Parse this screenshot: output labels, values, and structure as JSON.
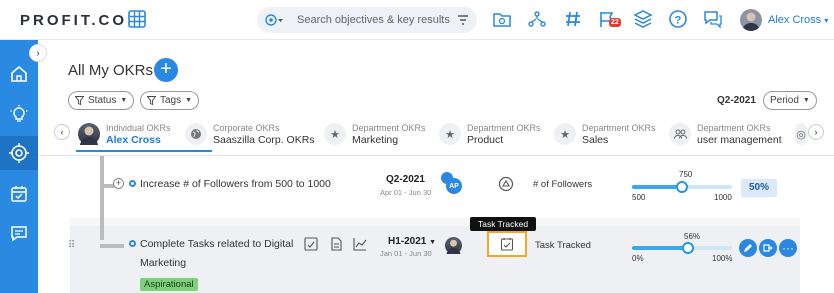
{
  "header": {
    "logo_text": "PROFIT.CO",
    "search_placeholder": "Search objectives & key results",
    "notification_count": "22",
    "user_name": "Alex Cross",
    "icons": [
      "grid-icon",
      "target-icon",
      "filter-icon",
      "folder-search-icon",
      "hierarchy-icon",
      "hashtag-icon",
      "flag-icon",
      "layers-icon",
      "help-icon",
      "chat-icon"
    ]
  },
  "sidebar": {
    "items": [
      {
        "name": "home-icon",
        "active": false
      },
      {
        "name": "lightbulb-icon",
        "active": false
      },
      {
        "name": "target-icon",
        "active": true
      },
      {
        "name": "calendar-check-icon",
        "active": false
      },
      {
        "name": "message-icon",
        "active": false
      }
    ]
  },
  "page": {
    "title": "All My OKRs",
    "filters": {
      "status": "Status",
      "tags": "Tags"
    },
    "period_value": "Q2-2021",
    "period_label": "Period"
  },
  "tabs": [
    {
      "sub": "Individual OKRs",
      "name": "Alex Cross",
      "icon": "avatar",
      "active": true
    },
    {
      "sub": "Corporate OKRs",
      "name": "Saaszilla Corp. OKRs",
      "icon": "globe-icon",
      "active": false
    },
    {
      "sub": "Department OKRs",
      "name": "Marketing",
      "icon": "star-icon",
      "active": false
    },
    {
      "sub": "Department OKRs",
      "name": "Product",
      "icon": "star-icon",
      "active": false
    },
    {
      "sub": "Department OKRs",
      "name": "Sales",
      "icon": "star-icon",
      "active": false
    },
    {
      "sub": "Department OKRs",
      "name": "user management",
      "icon": "users-icon",
      "active": false
    }
  ],
  "rows": [
    {
      "title": "Increase # of Followers from 500 to 1000",
      "period": "Q2-2021",
      "dates": "Apr 01 - Jun 30",
      "owner_initials": "AP",
      "metric": "# of Followers",
      "current": "750",
      "min": "500",
      "max": "1000",
      "progress": 0.5,
      "percent": "50%"
    },
    {
      "title_line1": "Complete Tasks related to Digital",
      "title_line2": "Marketing",
      "period": "H1-2021",
      "dates": "Jan 01 - Jun 30",
      "metric": "Task Tracked",
      "current": "56%",
      "min": "0%",
      "max": "100%",
      "progress": 0.56,
      "tag": "Aspirational",
      "tooltip": "Task Tracked"
    }
  ],
  "colors": {
    "accent": "#2a88e2",
    "sidebar": "#2a8ae2",
    "tag": "#7ed07a",
    "highlight": "#f5a623"
  }
}
